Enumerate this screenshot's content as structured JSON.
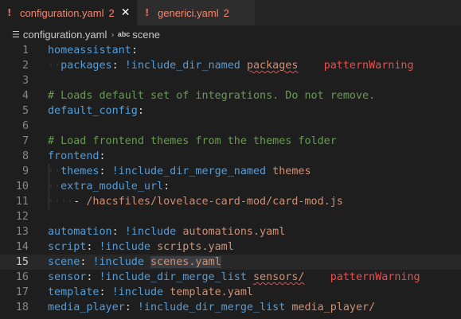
{
  "tabs": [
    {
      "title": "configuration.yaml",
      "problems": "2",
      "icon": "yaml-icon",
      "active": true,
      "close_glyph": "✕"
    },
    {
      "title": "generici.yaml",
      "problems": "2",
      "icon": "yaml-icon",
      "active": false
    }
  ],
  "breadcrumb": {
    "file": "configuration.yaml",
    "separator": "›",
    "symbol_icon": "abc",
    "symbol": "scene"
  },
  "current_line": "15",
  "lines": [
    {
      "n": "1",
      "tokens": [
        {
          "t": "homeassistant",
          "c": "k"
        },
        {
          "t": ":",
          "c": "p"
        }
      ]
    },
    {
      "n": "2",
      "tokens": [
        {
          "t": "··",
          "c": "ws"
        },
        {
          "t": "packages",
          "c": "k"
        },
        {
          "t": ": ",
          "c": "p"
        },
        {
          "t": "!include_dir_named",
          "c": "t"
        },
        {
          "t": " ",
          "c": "p"
        },
        {
          "t": "packages",
          "c": "s squiggle"
        },
        {
          "t": "    ",
          "c": "p"
        },
        {
          "t": "patternWarning",
          "c": "warn"
        }
      ]
    },
    {
      "n": "3",
      "tokens": []
    },
    {
      "n": "4",
      "tokens": [
        {
          "t": "# Loads default set of integrations. Do not remove.",
          "c": "c"
        }
      ]
    },
    {
      "n": "5",
      "tokens": [
        {
          "t": "default_config",
          "c": "k"
        },
        {
          "t": ":",
          "c": "p"
        }
      ]
    },
    {
      "n": "6",
      "tokens": []
    },
    {
      "n": "7",
      "tokens": [
        {
          "t": "# Load frontend themes from the themes folder",
          "c": "c"
        }
      ]
    },
    {
      "n": "8",
      "tokens": [
        {
          "t": "frontend",
          "c": "k"
        },
        {
          "t": ":",
          "c": "p"
        }
      ]
    },
    {
      "n": "9",
      "tokens": [
        {
          "t": "··",
          "c": "ws"
        },
        {
          "t": "themes",
          "c": "k"
        },
        {
          "t": ": ",
          "c": "p"
        },
        {
          "t": "!include_dir_merge_named",
          "c": "t"
        },
        {
          "t": " ",
          "c": "p"
        },
        {
          "t": "themes",
          "c": "s"
        }
      ]
    },
    {
      "n": "10",
      "tokens": [
        {
          "t": "··",
          "c": "ws"
        },
        {
          "t": "extra_module_url",
          "c": "k"
        },
        {
          "t": ":",
          "c": "p"
        }
      ]
    },
    {
      "n": "11",
      "tokens": [
        {
          "t": "····",
          "c": "ws"
        },
        {
          "t": "- ",
          "c": "p"
        },
        {
          "t": "/hacsfiles/lovelace-card-mod/card-mod.js",
          "c": "s"
        }
      ]
    },
    {
      "n": "12",
      "tokens": []
    },
    {
      "n": "13",
      "tokens": [
        {
          "t": "automation",
          "c": "k"
        },
        {
          "t": ": ",
          "c": "p"
        },
        {
          "t": "!include",
          "c": "t"
        },
        {
          "t": " ",
          "c": "p"
        },
        {
          "t": "automations.yaml",
          "c": "s"
        }
      ]
    },
    {
      "n": "14",
      "tokens": [
        {
          "t": "script",
          "c": "k"
        },
        {
          "t": ": ",
          "c": "p"
        },
        {
          "t": "!include",
          "c": "t"
        },
        {
          "t": " ",
          "c": "p"
        },
        {
          "t": "scripts.yaml",
          "c": "s"
        }
      ]
    },
    {
      "n": "15",
      "tokens": [
        {
          "t": "scene",
          "c": "k"
        },
        {
          "t": ": ",
          "c": "p"
        },
        {
          "t": "!include",
          "c": "t"
        },
        {
          "t": " ",
          "c": "p"
        },
        {
          "t": "scenes.yaml",
          "c": "s hl"
        }
      ]
    },
    {
      "n": "16",
      "tokens": [
        {
          "t": "sensor",
          "c": "k"
        },
        {
          "t": ": ",
          "c": "p"
        },
        {
          "t": "!include_dir_merge_list",
          "c": "t"
        },
        {
          "t": " ",
          "c": "p"
        },
        {
          "t": "sensors/",
          "c": "s squiggle"
        },
        {
          "t": "    ",
          "c": "p"
        },
        {
          "t": "patternWarning",
          "c": "warn"
        }
      ]
    },
    {
      "n": "17",
      "tokens": [
        {
          "t": "template",
          "c": "k"
        },
        {
          "t": ": ",
          "c": "p"
        },
        {
          "t": "!include",
          "c": "t"
        },
        {
          "t": " ",
          "c": "p"
        },
        {
          "t": "template.yaml",
          "c": "s"
        }
      ]
    },
    {
      "n": "18",
      "tokens": [
        {
          "t": "media_player",
          "c": "k"
        },
        {
          "t": ": ",
          "c": "p"
        },
        {
          "t": "!include_dir_merge_list",
          "c": "t"
        },
        {
          "t": " ",
          "c": "p"
        },
        {
          "t": "media_player/",
          "c": "s"
        }
      ]
    }
  ]
}
